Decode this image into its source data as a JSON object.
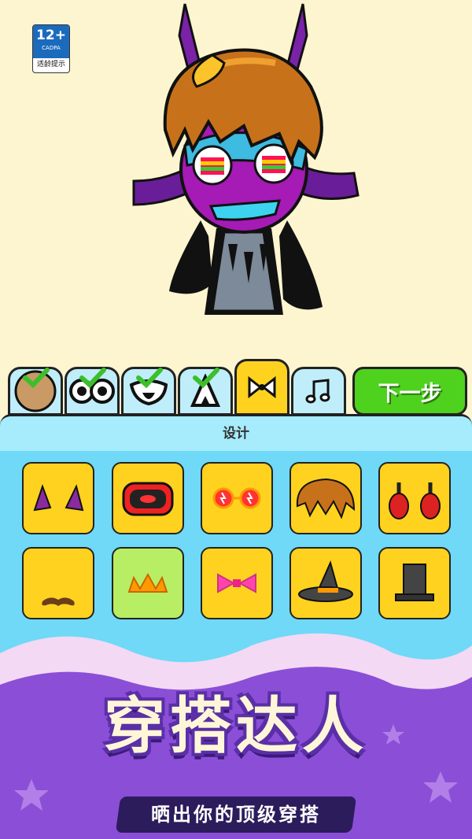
{
  "age_badge": {
    "rating": "12+",
    "org": "CADPA",
    "tip": "适龄提示"
  },
  "tabs": [
    {
      "name": "face",
      "checked": true
    },
    {
      "name": "eyes",
      "checked": true
    },
    {
      "name": "mouth",
      "checked": true
    },
    {
      "name": "body",
      "checked": true
    },
    {
      "name": "accessory",
      "checked": false,
      "active": true
    },
    {
      "name": "music",
      "checked": false
    }
  ],
  "next_button": {
    "label": "下一步"
  },
  "panel": {
    "title": "设计"
  },
  "items": [
    {
      "icon": "horn-ears-icon",
      "bg": "yellow"
    },
    {
      "icon": "red-mouth-icon",
      "bg": "yellow"
    },
    {
      "icon": "lightning-glasses-icon",
      "bg": "yellow"
    },
    {
      "icon": "brown-hair-icon",
      "bg": "yellow"
    },
    {
      "icon": "red-headphones-icon",
      "bg": "yellow"
    },
    {
      "icon": "mustache-icon",
      "bg": "yellow"
    },
    {
      "icon": "crown-icon",
      "bg": "green"
    },
    {
      "icon": "pink-bowtie-icon",
      "bg": "yellow"
    },
    {
      "icon": "witch-hat-icon",
      "bg": "yellow"
    },
    {
      "icon": "top-hat-icon",
      "bg": "yellow"
    }
  ],
  "banner": {
    "title": "穿搭达人",
    "subtitle": "晒出你的顶级穿搭"
  },
  "colors": {
    "background": "#fdf5d0",
    "panel": "#6fd9f7",
    "tab": "#bfeefa",
    "active_tab": "#ffd21f",
    "next": "#4ed21d",
    "cell": "#ffd21f",
    "cell_alt": "#b7ee63",
    "banner_purple": "#8a4fd6"
  }
}
